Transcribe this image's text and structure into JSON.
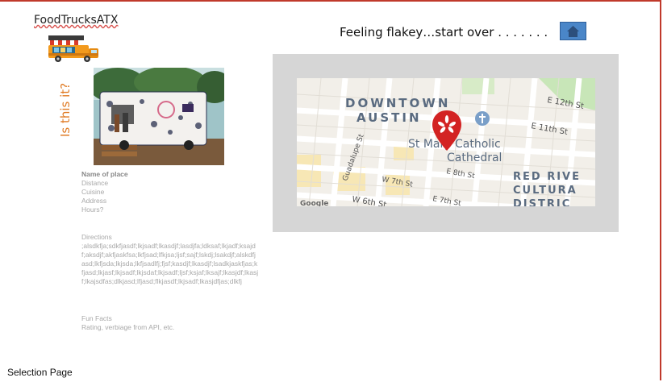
{
  "app": {
    "logo_text": "FoodTrucksATX"
  },
  "sidebar": {
    "vertical_label": "Is this it?"
  },
  "header": {
    "start_over_text": "Feeling flakey…start over . . . . . . ."
  },
  "home_button": {
    "icon": "home-icon",
    "color": "#4a86c8"
  },
  "details": {
    "name_label": "Name of place",
    "fields": [
      "Distance",
      "Cuisine",
      "Address",
      "Hours?"
    ],
    "directions_title": "Directions",
    "directions_text": ";alsdkfja;sdkfjasdf;lkjsadf;lkasdjf;lasdjfa;ldksaf;lkjadf;ksajdf;aksdjf;akfjaskfsa;lkfjsad;lfkjsa;ljsf;sajf;lskdj;lsakdjf;alskdfjasd;lkfjsda;lkjsda;lkfjsadlfj;fjsf;kasdjf;lkasdjf;lsadkjaskfjas;kfjasd;lkjasf;lkjsadf;lkjsdaf;lkjsadf;ljsf;ksjaf;lksajf;lkasjdf;lkasjf;lkajsdfas;dlkjasd;lfjasd;flkjasdf;lkjsadf;lkasjdfjas;dlkfj",
    "fun_facts_title": "Fun Facts",
    "fun_facts_text": "Rating, verbiage from API, etc."
  },
  "map": {
    "labels": {
      "downtown": "DOWNTOWN",
      "austin": "AUSTIN",
      "cathedral_1": "St Mary Catholic",
      "cathedral_2": "Cathedral",
      "district_1": "RED RIVE",
      "district_2": "CULTURA",
      "district_3": "DISTRIC",
      "st_12th": "E 12th St",
      "st_11th": "E 11th St",
      "st_8th": "E 8th St",
      "st_w7th": "W 7th St",
      "st_e7th": "E 7th St",
      "st_w6th": "W 6th St",
      "guadalupe": "Guadalupe St",
      "google": "Google"
    },
    "pin_color": "#d32323"
  },
  "footer": {
    "page_label": "Selection Page"
  }
}
